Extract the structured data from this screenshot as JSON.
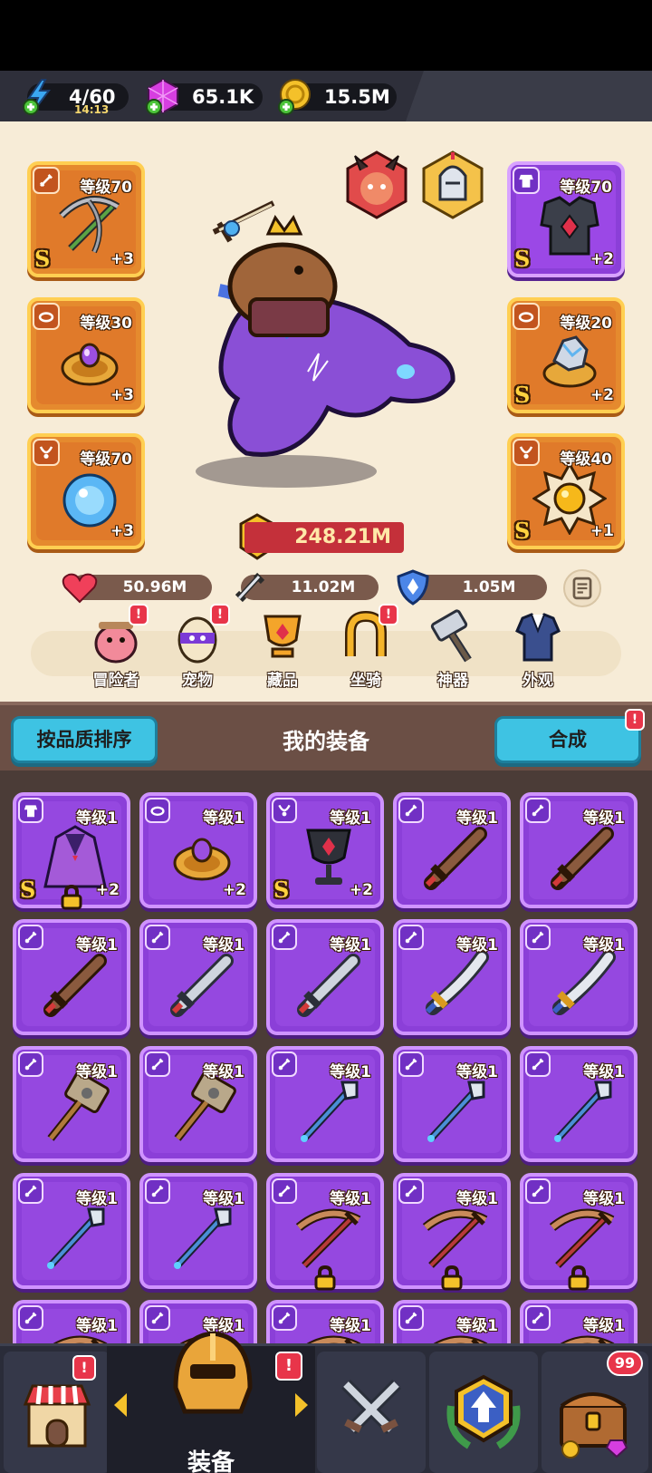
{
  "currencies": {
    "energy": {
      "value": "4/60",
      "timer": "14:13",
      "icon": "lightning-icon"
    },
    "gems": {
      "value": "65.1K",
      "icon": "gem-icon"
    },
    "gold": {
      "value": "15.5M",
      "icon": "gold-coin-icon"
    }
  },
  "equipped": {
    "left": [
      {
        "type": "weapon",
        "level": "等级70",
        "plus": "+3",
        "rank": "S",
        "icon": "crossbow-icon"
      },
      {
        "type": "ring",
        "level": "等级30",
        "plus": "+3",
        "rank": "",
        "icon": "ring-icon"
      },
      {
        "type": "necklace",
        "level": "等级70",
        "plus": "+3",
        "rank": "",
        "icon": "orb-necklace-icon"
      }
    ],
    "right": [
      {
        "type": "armor",
        "level": "等级70",
        "plus": "+2",
        "rank": "S",
        "icon": "armor-icon"
      },
      {
        "type": "ring",
        "level": "等级20",
        "plus": "+2",
        "rank": "S",
        "icon": "crystal-ring-icon"
      },
      {
        "type": "necklace",
        "level": "等级40",
        "plus": "+1",
        "rank": "S",
        "icon": "sun-amulet-icon"
      }
    ]
  },
  "power": "248.21M",
  "stats": {
    "hp": "50.96M",
    "attack": "11.02M",
    "defense": "1.05M"
  },
  "menu": [
    {
      "label": "冒险者",
      "alert": "!"
    },
    {
      "label": "宠物",
      "alert": "!"
    },
    {
      "label": "藏品",
      "alert": ""
    },
    {
      "label": "坐骑",
      "alert": "!"
    },
    {
      "label": "神器",
      "alert": ""
    },
    {
      "label": "外观",
      "alert": ""
    }
  ],
  "inventory": {
    "sort_label": "按品质排序",
    "title": "我的装备",
    "merge_label": "合成",
    "merge_alert": "!",
    "items": [
      {
        "level": "等级1",
        "plus": "+2",
        "rank": "S",
        "locked": true,
        "art": "cloak",
        "badge": "armor"
      },
      {
        "level": "等级1",
        "plus": "+2",
        "rank": "",
        "locked": false,
        "art": "ring",
        "badge": "ring"
      },
      {
        "level": "等级1",
        "plus": "+2",
        "rank": "S",
        "locked": false,
        "art": "chalice",
        "badge": "necklace"
      },
      {
        "level": "等级1",
        "plus": "",
        "rank": "",
        "locked": false,
        "art": "wood-sword",
        "badge": "weapon"
      },
      {
        "level": "等级1",
        "plus": "",
        "rank": "",
        "locked": false,
        "art": "wood-sword",
        "badge": "weapon"
      },
      {
        "level": "等级1",
        "plus": "",
        "rank": "",
        "locked": false,
        "art": "wood-sword",
        "badge": "weapon"
      },
      {
        "level": "等级1",
        "plus": "",
        "rank": "",
        "locked": false,
        "art": "iron-sword",
        "badge": "weapon"
      },
      {
        "level": "等级1",
        "plus": "",
        "rank": "",
        "locked": false,
        "art": "iron-sword",
        "badge": "weapon"
      },
      {
        "level": "等级1",
        "plus": "",
        "rank": "",
        "locked": false,
        "art": "gold-sword",
        "badge": "weapon"
      },
      {
        "level": "等级1",
        "plus": "",
        "rank": "",
        "locked": false,
        "art": "gold-sword",
        "badge": "weapon"
      },
      {
        "level": "等级1",
        "plus": "",
        "rank": "",
        "locked": false,
        "art": "hammer",
        "badge": "weapon"
      },
      {
        "level": "等级1",
        "plus": "",
        "rank": "",
        "locked": false,
        "art": "hammer",
        "badge": "weapon"
      },
      {
        "level": "等级1",
        "plus": "",
        "rank": "",
        "locked": false,
        "art": "spear",
        "badge": "weapon"
      },
      {
        "level": "等级1",
        "plus": "",
        "rank": "",
        "locked": false,
        "art": "spear",
        "badge": "weapon"
      },
      {
        "level": "等级1",
        "plus": "",
        "rank": "",
        "locked": false,
        "art": "spear",
        "badge": "weapon"
      },
      {
        "level": "等级1",
        "plus": "",
        "rank": "",
        "locked": false,
        "art": "spear",
        "badge": "weapon"
      },
      {
        "level": "等级1",
        "plus": "",
        "rank": "",
        "locked": false,
        "art": "spear",
        "badge": "weapon"
      },
      {
        "level": "等级1",
        "plus": "",
        "rank": "",
        "locked": true,
        "art": "bow",
        "badge": "weapon"
      },
      {
        "level": "等级1",
        "plus": "",
        "rank": "",
        "locked": true,
        "art": "bow",
        "badge": "weapon"
      },
      {
        "level": "等级1",
        "plus": "",
        "rank": "",
        "locked": true,
        "art": "bow",
        "badge": "weapon"
      },
      {
        "level": "等级1",
        "plus": "",
        "rank": "",
        "locked": false,
        "art": "bow",
        "badge": "weapon"
      },
      {
        "level": "等级1",
        "plus": "",
        "rank": "",
        "locked": false,
        "art": "bow",
        "badge": "weapon"
      },
      {
        "level": "等级1",
        "plus": "",
        "rank": "",
        "locked": false,
        "art": "bow",
        "badge": "weapon"
      },
      {
        "level": "等级1",
        "plus": "",
        "rank": "",
        "locked": false,
        "art": "bow",
        "badge": "weapon"
      },
      {
        "level": "等级1",
        "plus": "",
        "rank": "",
        "locked": false,
        "art": "bow",
        "badge": "weapon"
      }
    ]
  },
  "nav": {
    "shop_alert": "!",
    "equip_label": "装备",
    "equip_alert": "!",
    "chest_badge": "99"
  },
  "colors": {
    "orange_slot": "#e58a2e",
    "purple_slot": "#8b3fd8",
    "power_red": "#c4303a",
    "cyan_button": "#3ec3e3"
  }
}
